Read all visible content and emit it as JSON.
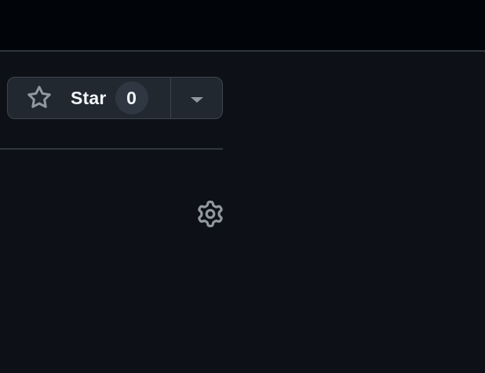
{
  "star_button": {
    "label": "Star",
    "count": "0",
    "icon": "star-outline-icon"
  },
  "dropdown": {
    "icon": "triangle-down-icon"
  },
  "settings": {
    "icon": "gear-icon"
  },
  "colors": {
    "background": "#0d1117",
    "top_bar": "#010409",
    "button_bg": "#212830",
    "button_border": "#3d444d",
    "text": "#f0f6fc",
    "muted_icon": "#9198a1"
  }
}
